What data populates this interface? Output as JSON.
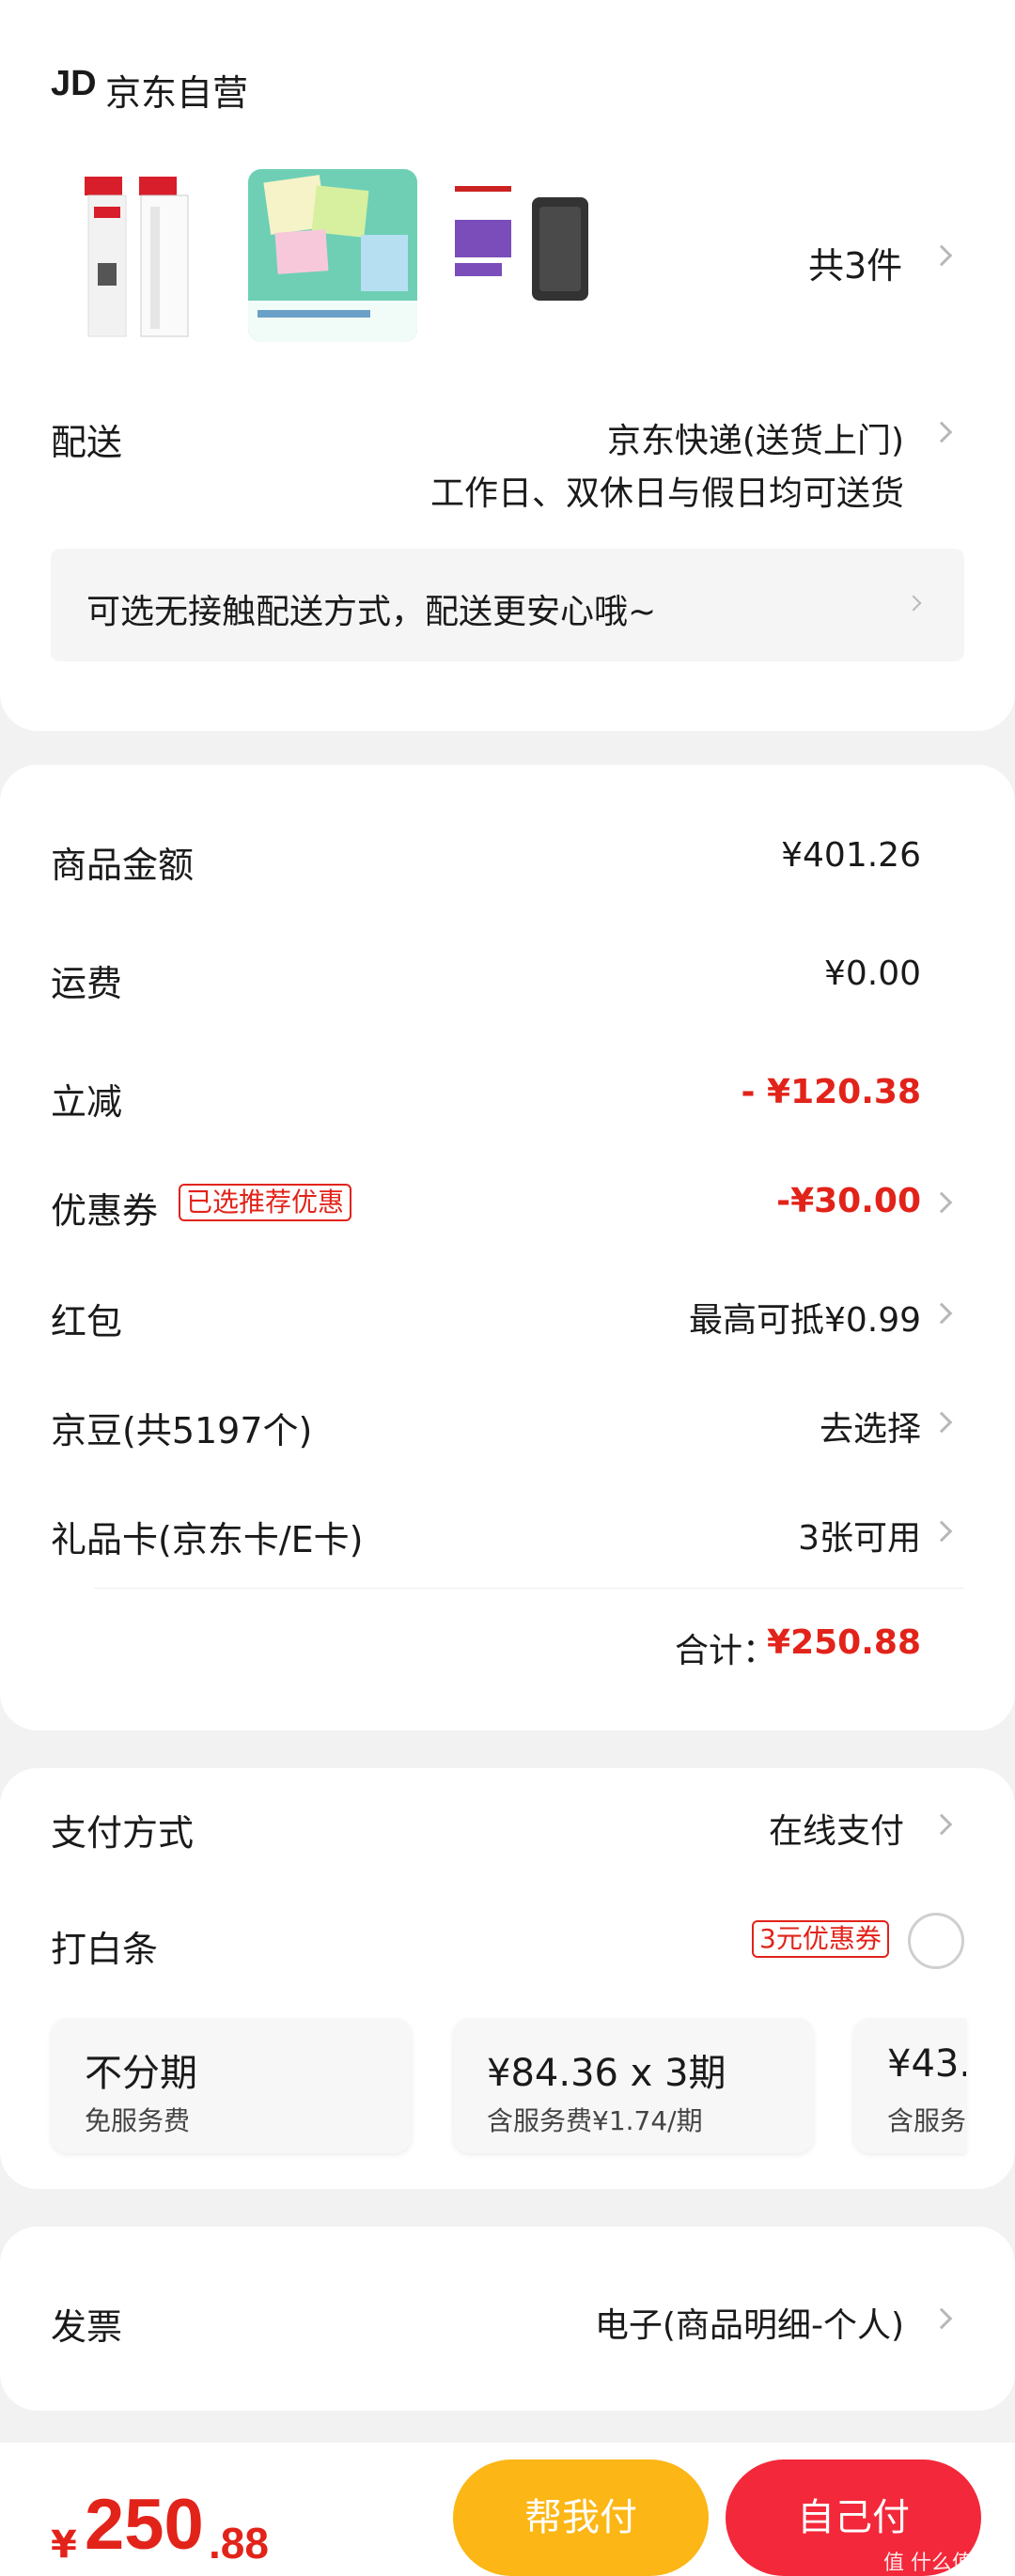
{
  "store": {
    "logo": "JD",
    "name": "京东自营"
  },
  "products": {
    "count_label": "共3件"
  },
  "delivery": {
    "label": "配送",
    "line1": "京东快递(送货上门)",
    "line2": "工作日、双休日与假日均可送货",
    "contactless": "可选无接触配送方式，配送更安心哦~"
  },
  "price": {
    "goods_label": "商品金额",
    "goods_value": "¥401.26",
    "freight_label": "运费",
    "freight_value": "¥0.00",
    "discount_label": "立减",
    "discount_value": "- ¥120.38",
    "coupon_label": "优惠券",
    "coupon_tag": "已选推荐优惠",
    "coupon_value": "-¥30.00",
    "redpack_label": "红包",
    "redpack_value": "最高可抵¥0.99",
    "jingdou_label": "京豆(共5197个)",
    "jingdou_value": "去选择",
    "giftcard_label": "礼品卡(京东卡/E卡)",
    "giftcard_value": "3张可用",
    "total_label": "合计：",
    "total_value": "¥250.88"
  },
  "payment": {
    "method_label": "支付方式",
    "method_value": "在线支付",
    "baitiao_label": "打白条",
    "baitiao_tag": "3元优惠券",
    "plans": [
      {
        "title": "不分期",
        "sub": "免服务费"
      },
      {
        "title": "¥84.36 x 3期",
        "sub": "含服务费¥1.74/期"
      },
      {
        "title": "¥43.",
        "sub": "含服务"
      }
    ]
  },
  "invoice": {
    "label": "发票",
    "value": "电子(商品明细-个人)"
  },
  "bottom": {
    "currency": "¥",
    "amount_int": "250",
    "amount_dec": ".88",
    "help_pay": "帮我付",
    "self_pay": "自己付",
    "watermark": "值 什么值得买"
  },
  "colors": {
    "accent_red": "#e2231a",
    "help_btn": "#fcb615",
    "pay_btn": "#f3283a",
    "bg": "#f2f2f2"
  }
}
